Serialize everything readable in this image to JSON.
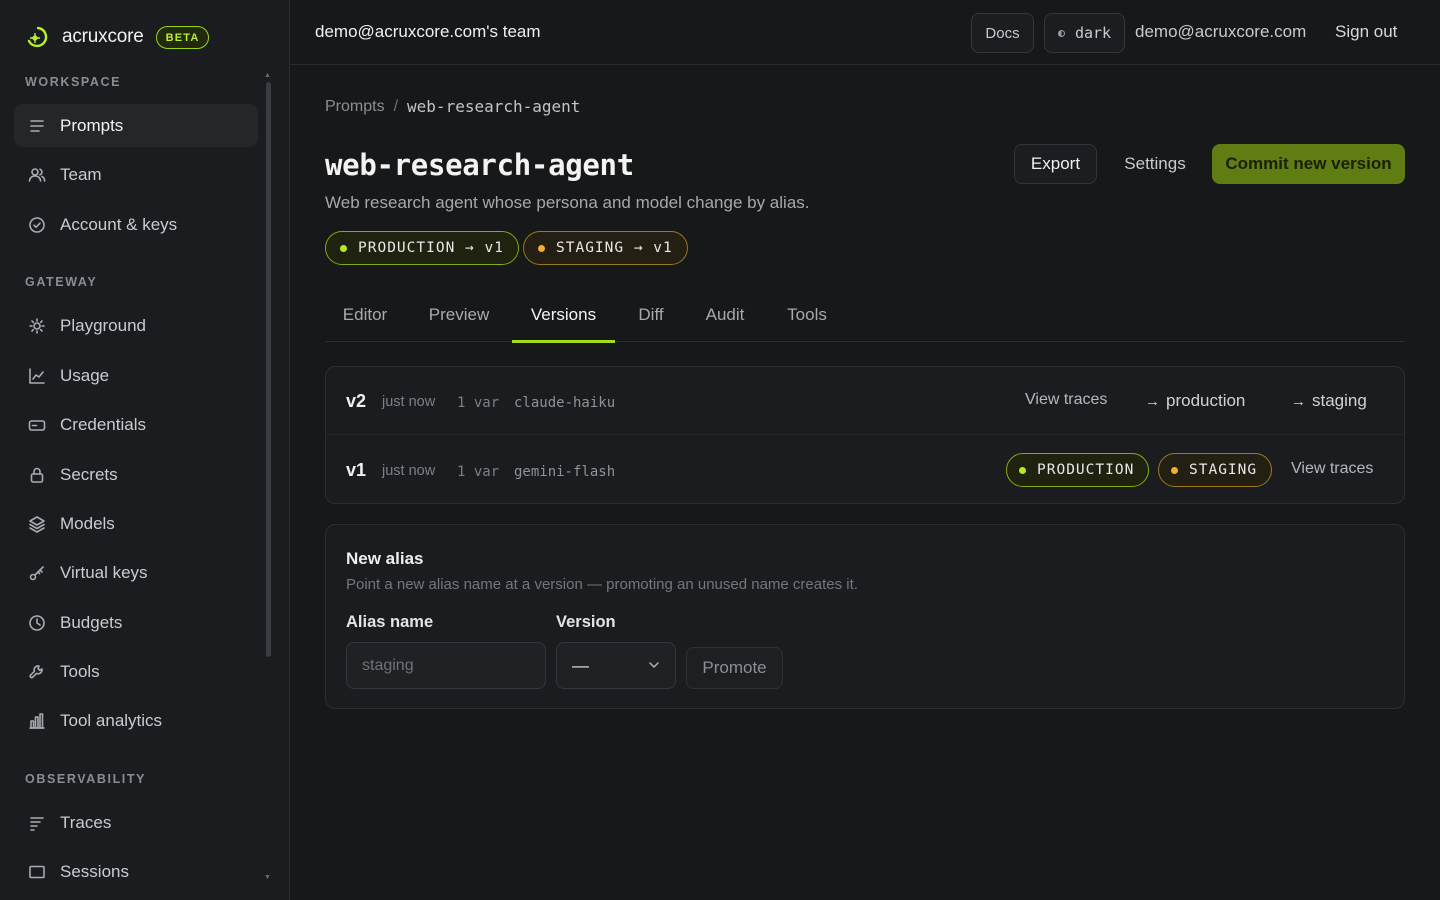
{
  "brand": {
    "name": "acruxcore",
    "badge": "BETA",
    "accent": "#b7ee2d"
  },
  "sidebar": {
    "sections": [
      {
        "title": "WORKSPACE"
      },
      {
        "title": "GATEWAY"
      },
      {
        "title": "OBSERVABILITY"
      }
    ],
    "items": [
      {
        "label": "Prompts",
        "icon": "list-icon",
        "active": true
      },
      {
        "label": "Team",
        "icon": "users-icon"
      },
      {
        "label": "Account & keys",
        "icon": "check-circle-icon"
      },
      {
        "label": "Playground",
        "icon": "sun-icon"
      },
      {
        "label": "Usage",
        "icon": "line-chart-icon"
      },
      {
        "label": "Credentials",
        "icon": "card-icon"
      },
      {
        "label": "Secrets",
        "icon": "lock-icon"
      },
      {
        "label": "Models",
        "icon": "layers-icon"
      },
      {
        "label": "Virtual keys",
        "icon": "key-icon"
      },
      {
        "label": "Budgets",
        "icon": "clock-icon"
      },
      {
        "label": "Tools",
        "icon": "wrench-icon"
      },
      {
        "label": "Tool analytics",
        "icon": "bar-chart-icon"
      },
      {
        "label": "Traces",
        "icon": "traces-icon"
      },
      {
        "label": "Sessions",
        "icon": "window-icon"
      }
    ]
  },
  "topbar": {
    "team": "demo@acruxcore.com's team",
    "docs": "Docs",
    "theme": "dark",
    "email": "demo@acruxcore.com",
    "signout": "Sign out"
  },
  "page": {
    "breadcrumb_root": "Prompts",
    "breadcrumb_sep": "/",
    "breadcrumb_current": "web-research-agent",
    "title": "web-research-agent",
    "description": "Web research agent whose persona and model change by alias.",
    "export": "Export",
    "settings": "Settings",
    "commit": "Commit new version",
    "aliases": [
      {
        "label": "PRODUCTION → v1",
        "color": "#b5ea1f"
      },
      {
        "label": "STAGING → v1",
        "color": "#f0b02b"
      }
    ]
  },
  "tabs": [
    {
      "label": "Editor"
    },
    {
      "label": "Preview"
    },
    {
      "label": "Versions",
      "active": true
    },
    {
      "label": "Diff"
    },
    {
      "label": "Audit"
    },
    {
      "label": "Tools"
    }
  ],
  "versions": [
    {
      "name": "v2",
      "time": "just now",
      "vars": "1 var",
      "model": "claude-haiku",
      "view_traces": "View traces",
      "promote_production": "production",
      "promote_staging": "staging"
    },
    {
      "name": "v1",
      "time": "just now",
      "vars": "1 var",
      "model": "gemini-flash",
      "badge_production": "PRODUCTION",
      "badge_staging": "STAGING",
      "view_traces": "View traces"
    }
  ],
  "new_alias": {
    "title": "New alias",
    "subtitle": "Point a new alias name at a version — promoting an unused name creates it.",
    "alias_label": "Alias name",
    "alias_placeholder": "staging",
    "version_label": "Version",
    "version_value": "—",
    "promote": "Promote"
  }
}
